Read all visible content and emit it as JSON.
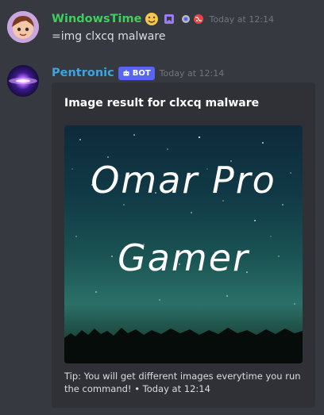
{
  "messages": [
    {
      "username": "WindowsTime",
      "username_color": "#3ecf5c",
      "timestamp": "Today at 12:14",
      "content": "=img clxcq malware",
      "badges": [
        "smiley-emoji-icon",
        "nitro-badge-icon",
        "server-booster-icon",
        "globe-icon"
      ]
    },
    {
      "username": "Pentronic",
      "username_color": "#3ba5e0",
      "bot_tag": "BOT",
      "timestamp": "Today at 12:14",
      "embed": {
        "title": "Image result for clxcq malware",
        "image_text": [
          "Omar Pro",
          "Gamer"
        ],
        "footer_text": "Tip: You will get different images everytime you run the command! • Today at 12:14"
      }
    }
  ],
  "colors": {
    "background": "#36393f",
    "embed_background": "#2f3136",
    "timestamp": "#72767d",
    "bot_tag": "#5865f2"
  }
}
